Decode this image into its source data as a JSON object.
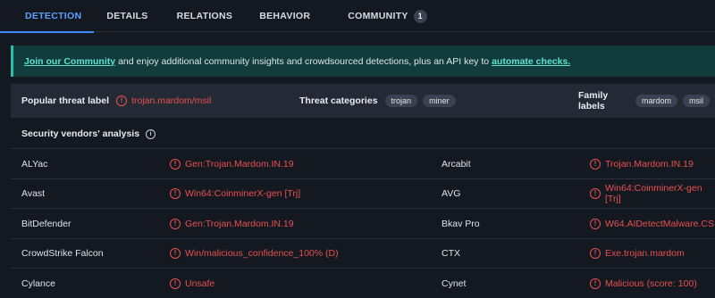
{
  "tabs": [
    {
      "label": "DETECTION",
      "active": true
    },
    {
      "label": "DETAILS"
    },
    {
      "label": "RELATIONS"
    },
    {
      "label": "BEHAVIOR"
    },
    {
      "label": "COMMUNITY",
      "badge": "1"
    }
  ],
  "banner": {
    "join_link": "Join our Community",
    "middle_text": "and enjoy additional community insights and crowdsourced detections, plus an API key to",
    "automate_link": "automate checks."
  },
  "summary": {
    "popular_label_title": "Popular threat label",
    "popular_label_value": "trojan.mardom/msil",
    "categories_title": "Threat categories",
    "categories": [
      "trojan",
      "miner"
    ],
    "family_title": "Family labels",
    "families": [
      "mardom",
      "msil"
    ]
  },
  "section": {
    "title": "Security vendors' analysis"
  },
  "vendors": [
    {
      "left": {
        "name": "ALYac",
        "result": "Gen:Trojan.Mardom.IN.19"
      },
      "right": {
        "name": "Arcabit",
        "result": "Trojan.Mardom.IN.19"
      }
    },
    {
      "left": {
        "name": "Avast",
        "result": "Win64:CoinminerX-gen [Trj]"
      },
      "right": {
        "name": "AVG",
        "result": "Win64:CoinminerX-gen [Trj]"
      }
    },
    {
      "left": {
        "name": "BitDefender",
        "result": "Gen:Trojan.Mardom.IN.19"
      },
      "right": {
        "name": "Bkav Pro",
        "result": "W64.AIDetectMalware.CS"
      }
    },
    {
      "left": {
        "name": "CrowdStrike Falcon",
        "result": "Win/malicious_confidence_100% (D)"
      },
      "right": {
        "name": "CTX",
        "result": "Exe.trojan.mardom"
      }
    },
    {
      "left": {
        "name": "Cylance",
        "result": "Unsafe"
      },
      "right": {
        "name": "Cynet",
        "result": "Malicious (score: 100)"
      }
    }
  ],
  "colors": {
    "accent": "#3d8bff",
    "malicious": "#e8514f",
    "banner_bg": "#123c3c",
    "bg": "#141821"
  }
}
